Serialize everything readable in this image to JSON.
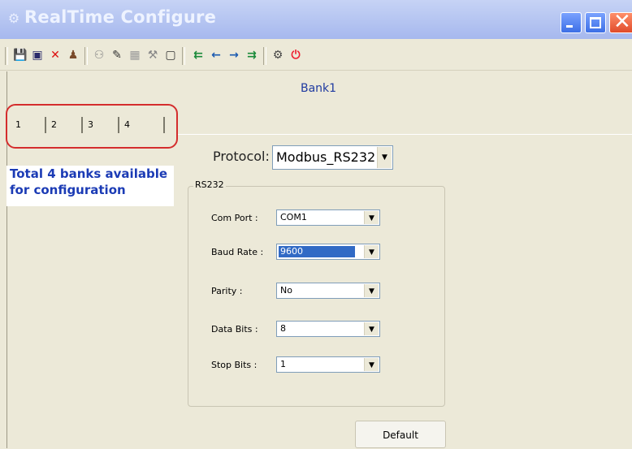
{
  "window": {
    "title": "RealTime Configure"
  },
  "main": {
    "bank_title": "Bank1",
    "tabs": [
      "1",
      "2",
      "3",
      "4"
    ],
    "note_line1": "Total 4 banks available",
    "note_line2": "for configuration",
    "protocol": {
      "label": "Protocol:",
      "value": "Modbus_RS232"
    },
    "group": {
      "legend": "RS232",
      "fields": [
        {
          "label": "Com Port :",
          "value": "COM1"
        },
        {
          "label": "Baud Rate :",
          "value": "9600"
        },
        {
          "label": "Parity :",
          "value": "No"
        },
        {
          "label": "Data Bits :",
          "value": "8"
        },
        {
          "label": "Stop Bits :",
          "value": "1"
        }
      ]
    },
    "default_button": "Default"
  },
  "toolbar_icons": [
    "save-icon",
    "window-icon",
    "delete-icon",
    "user-icon",
    "users-icon",
    "edit-icon",
    "grid-icon",
    "tools-icon",
    "copy-icon",
    "move-left-all-icon",
    "arrow-left-icon",
    "arrow-right-icon",
    "move-right-all-icon",
    "settings-icon",
    "power-icon"
  ],
  "colors": {
    "title_bar": "#a6b8ee",
    "accent": "#1b3bb5",
    "highlight": "#316AC5",
    "annotation": "#d42d2d"
  }
}
